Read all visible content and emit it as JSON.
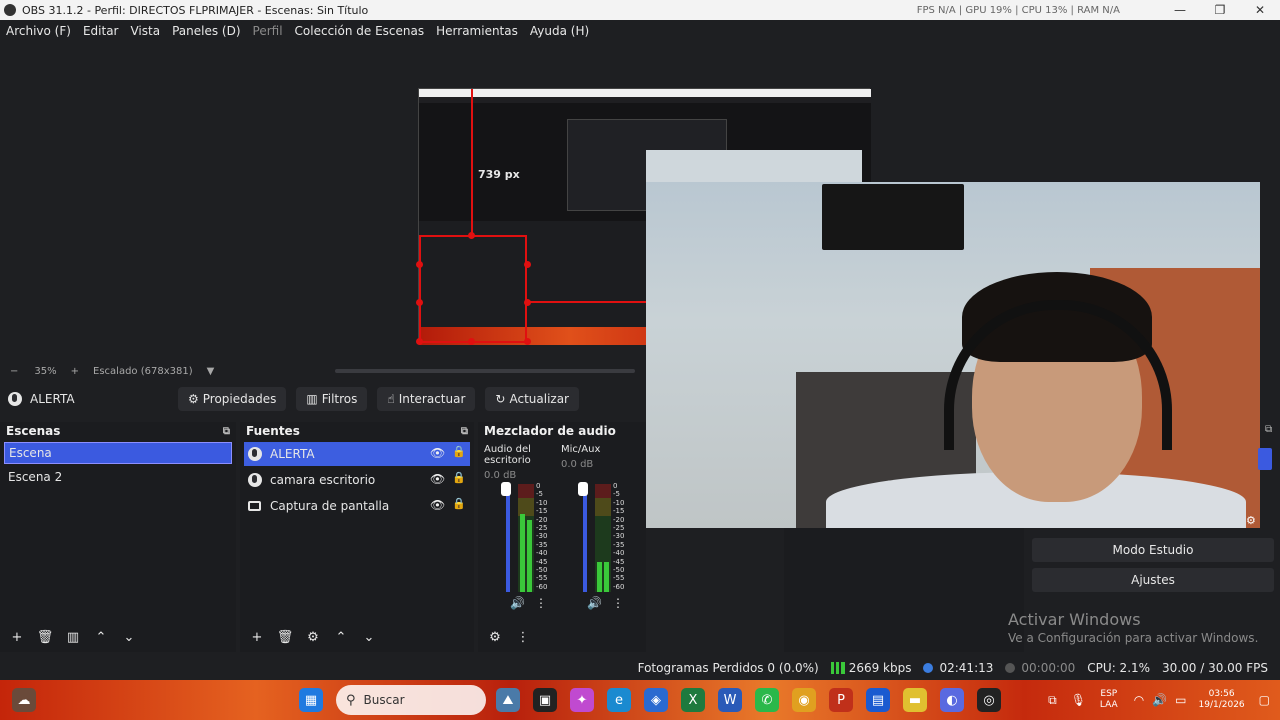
{
  "window": {
    "title": "OBS 31.1.2 - Perfil: DIRECTOS FLPRIMAJER - Escenas: Sin Título",
    "stats": "FPS N/A  |  GPU 19%  |  CPU 13%  |  RAM N/A",
    "minimize": "—",
    "maximize": "❐",
    "close": "✕"
  },
  "menu": {
    "items": [
      "Archivo (F)",
      "Editar",
      "Vista",
      "Paneles (D)",
      "Perfil",
      "Colección de Escenas",
      "Herramientas",
      "Ayuda (H)"
    ]
  },
  "preview": {
    "px_label": "739 px",
    "zoom_minus": "−",
    "zoom": "35%",
    "zoom_plus": "+",
    "scale": "Escalado (678x381)"
  },
  "source_toolbar": {
    "selected_source": "ALERTA",
    "properties": "Propiedades",
    "filters": "Filtros",
    "interact": "Interactuar",
    "refresh": "Actualizar"
  },
  "scenes": {
    "title": "Escenas",
    "items": [
      "Escena",
      "Escena 2"
    ]
  },
  "sources": {
    "title": "Fuentes",
    "items": [
      "ALERTA",
      "camara escritorio",
      "Captura de pantalla"
    ]
  },
  "mixer": {
    "title": "Mezclador de audio",
    "channels": [
      {
        "name": "Audio del escritorio",
        "db": "0.0 dB"
      },
      {
        "name": "Mic/Aux",
        "db": "0.0 dB"
      }
    ],
    "ticks": [
      "0",
      "-5",
      "-10",
      "-15",
      "-20",
      "-25",
      "-30",
      "-35",
      "-40",
      "-45",
      "-50",
      "-55",
      "-60"
    ]
  },
  "controls": {
    "studio_mode": "Modo Estudio",
    "settings": "Ajustes"
  },
  "watermark": {
    "line1": "Activar Windows",
    "line2": "Ve a Configuración para activar Windows."
  },
  "status": {
    "dropped": "Fotogramas Perdidos 0 (0.0%)",
    "bitrate": "2669 kbps",
    "stream_time": "02:41:13",
    "rec_time": "00:00:00",
    "cpu": "CPU: 2.1%",
    "fps": "30.00 / 30.00 FPS"
  },
  "taskbar": {
    "search_placeholder": "Buscar",
    "lang1": "ESP",
    "lang2": "LAA",
    "time": "03:56",
    "date": "19/1/2026"
  },
  "colors": {
    "accent": "#3d5ee0",
    "selection_red": "#e01010",
    "background": "#1e1f22"
  }
}
